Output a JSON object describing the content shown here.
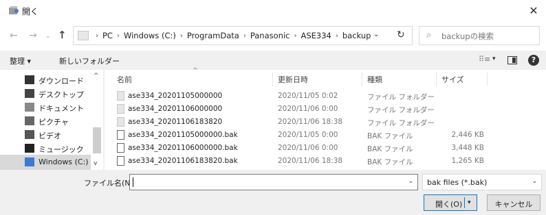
{
  "window": {
    "title": "開く",
    "close_icon": "close-icon"
  },
  "navigation": {
    "back_icon": "←",
    "forward_icon": "→",
    "recent_icon": "⌄",
    "up_icon": "↑",
    "breadcrumbs": [
      "PC",
      "Windows (C:)",
      "ProgramData",
      "Panasonic",
      "ASE334",
      "backup"
    ],
    "crumb_separator": "›",
    "address_dropdown": "⌄",
    "refresh_icon": "↻",
    "search_icon": "⌕",
    "search_placeholder": "backupの検索"
  },
  "toolbar": {
    "organize_label": "整理 ▾",
    "new_folder_label": "新しいフォルダー",
    "view_icon": "⠿≡",
    "view_dropdown": "▾",
    "help_label": "?"
  },
  "nav_pane": {
    "items": [
      {
        "label": "ダウンロード",
        "icon": "download-icon",
        "selected": false
      },
      {
        "label": "デスクトップ",
        "icon": "desktop-icon",
        "selected": false
      },
      {
        "label": "ドキュメント",
        "icon": "documents-icon",
        "selected": false
      },
      {
        "label": "ピクチャ",
        "icon": "pictures-icon",
        "selected": false
      },
      {
        "label": "ビデオ",
        "icon": "videos-icon",
        "selected": false
      },
      {
        "label": "ミュージック",
        "icon": "music-icon",
        "selected": false
      },
      {
        "label": "Windows (C:)",
        "icon": "drive-icon",
        "selected": true
      }
    ],
    "scroll_up": "^",
    "scroll_down": "v"
  },
  "file_list": {
    "columns": [
      "名前",
      "更新日時",
      "種類",
      "サイズ"
    ],
    "sort_indicator": "^",
    "rows": [
      {
        "name": "ase334_20201105000000",
        "date": "2020/11/05 0:02",
        "type": "ファイル フォルダー",
        "size": "",
        "kind": "folder"
      },
      {
        "name": "ase334_20201106000000",
        "date": "2020/11/06 0:00",
        "type": "ファイル フォルダー",
        "size": "",
        "kind": "folder"
      },
      {
        "name": "ase334_20201106183820",
        "date": "2020/11/06 18:38",
        "type": "ファイル フォルダー",
        "size": "",
        "kind": "folder"
      },
      {
        "name": "ase334_20201105000000.bak",
        "date": "2020/11/05 0:00",
        "type": "BAK ファイル",
        "size": "2,446 KB",
        "kind": "file"
      },
      {
        "name": "ase334_20201106000000.bak",
        "date": "2020/11/06 0:00",
        "type": "BAK ファイル",
        "size": "3,448 KB",
        "kind": "file"
      },
      {
        "name": "ase334_20201106183820.bak",
        "date": "2020/11/06 18:38",
        "type": "BAK ファイル",
        "size": "1,265 KB",
        "kind": "file"
      }
    ]
  },
  "footer": {
    "filename_label": "ファイル名(N):",
    "filename_value": "",
    "filename_dropdown": "⌄",
    "filter_value": "bak files (*.bak)",
    "filter_dropdown": "⌄",
    "open_label": "開く(O)",
    "open_dropdown": "▾",
    "cancel_label": "キャンセル"
  },
  "colors": {
    "accent": "#0078d7",
    "selection": "#d9d9d9",
    "window_bg": "#f0f0f0"
  }
}
